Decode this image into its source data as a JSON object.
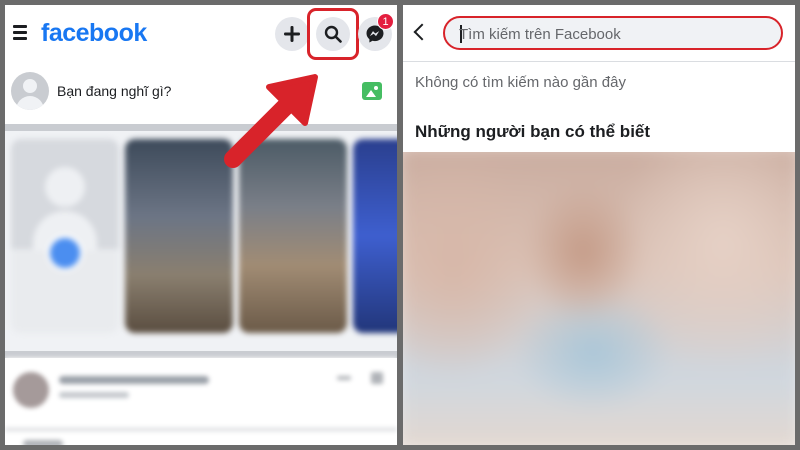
{
  "left": {
    "logo": "facebook",
    "icons": {
      "menu": "hamburger-icon",
      "create": "plus-icon",
      "search": "search-icon",
      "messenger": "messenger-icon",
      "photo": "photo-icon"
    },
    "messenger_badge": "1",
    "composer_placeholder": "Bạn đang nghĩ gì?"
  },
  "right": {
    "search_placeholder": "Tìm kiếm trên Facebook",
    "no_recent": "Không có tìm kiếm nào gần đây",
    "people_you_may_know": "Những người bạn có thể biết"
  },
  "colors": {
    "brand": "#1877f2",
    "highlight": "#d8232a",
    "badge": "#e41e3f"
  }
}
